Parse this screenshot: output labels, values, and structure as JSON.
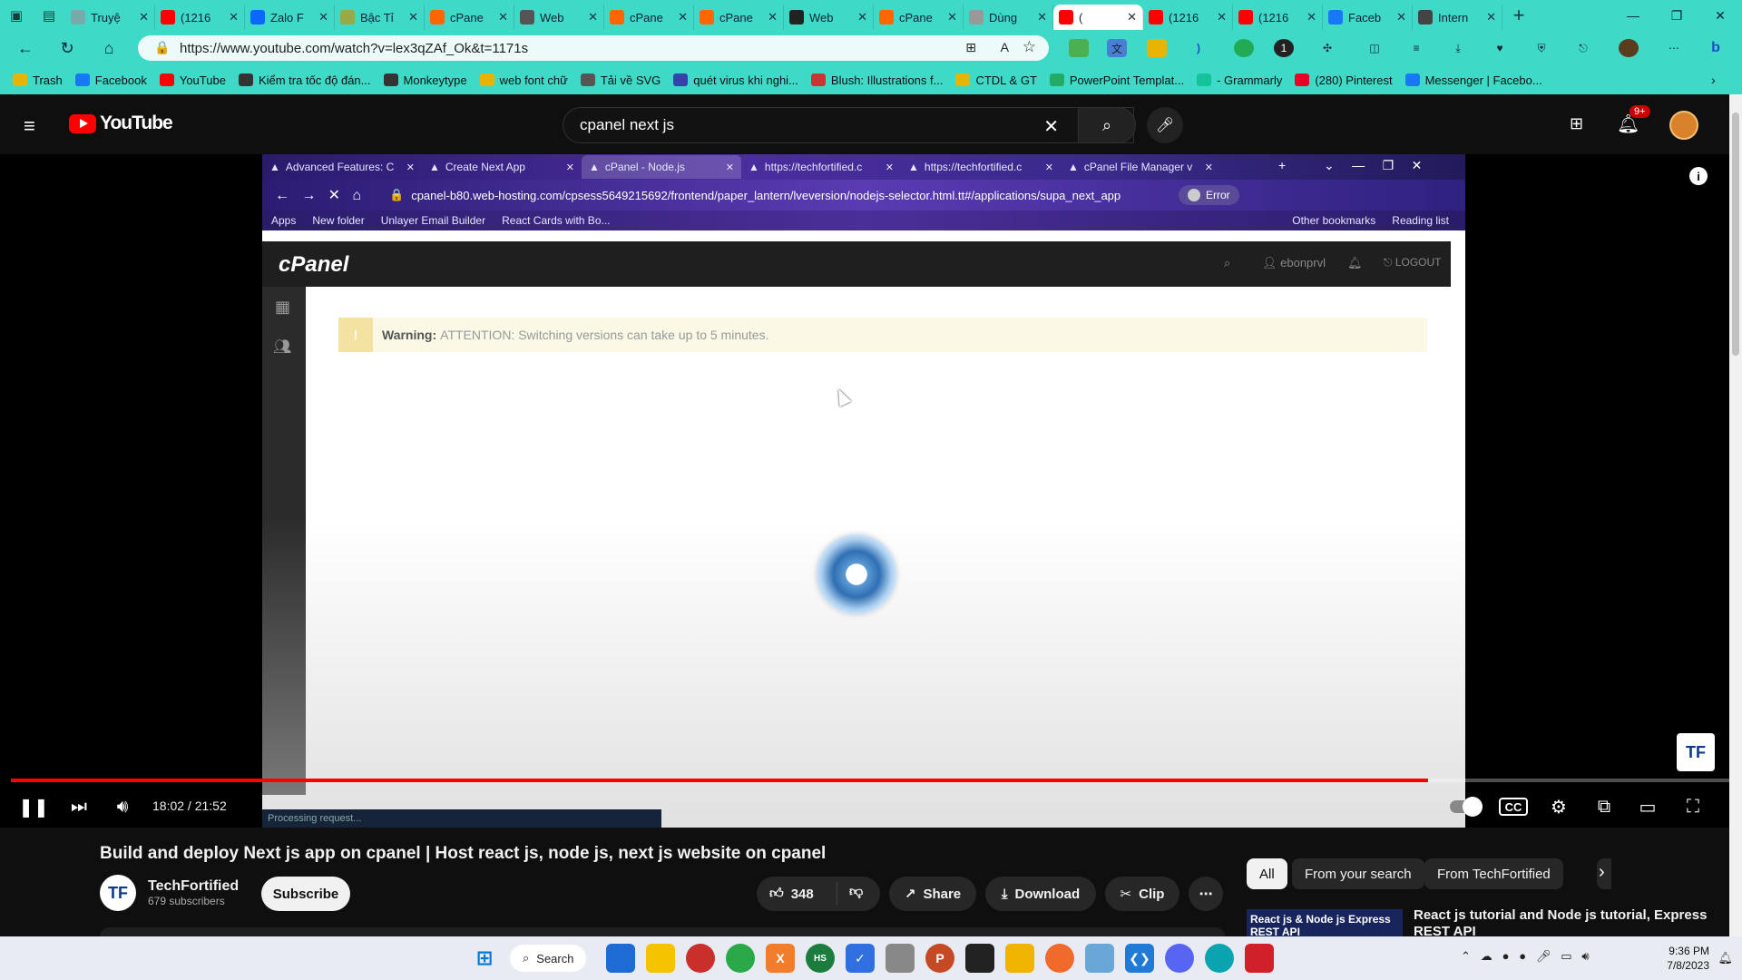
{
  "browser": {
    "tabs": [
      {
        "label": "Truyệ",
        "color": "#7aa"
      },
      {
        "label": "(1216",
        "color": "#f00"
      },
      {
        "label": "Zalo F",
        "color": "#0a68ff"
      },
      {
        "label": "Bậc Tỉ",
        "color": "#9a4"
      },
      {
        "label": "cPane",
        "color": "#f60"
      },
      {
        "label": "Web",
        "color": "#555"
      },
      {
        "label": "cPane",
        "color": "#f60"
      },
      {
        "label": "cPane",
        "color": "#f60"
      },
      {
        "label": "Web",
        "color": "#222"
      },
      {
        "label": "cPane",
        "color": "#f60"
      },
      {
        "label": "Dùng",
        "color": "#999"
      },
      {
        "label": "(",
        "color": "#f00",
        "active": true
      },
      {
        "label": "(1216",
        "color": "#f00"
      },
      {
        "label": "(1216",
        "color": "#f00"
      },
      {
        "label": "Faceb",
        "color": "#1877f2"
      },
      {
        "label": "Intern",
        "color": "#444"
      }
    ],
    "url": "https://www.youtube.com/watch?v=lex3qZAf_Ok&t=1171s",
    "bookmarks": [
      {
        "label": "Trash",
        "color": "#e8b400"
      },
      {
        "label": "Facebook",
        "color": "#1877f2"
      },
      {
        "label": "YouTube",
        "color": "#f00"
      },
      {
        "label": "Kiểm tra tốc độ đán...",
        "color": "#333"
      },
      {
        "label": "Monkeytype",
        "color": "#333"
      },
      {
        "label": "web font chữ",
        "color": "#e8b400"
      },
      {
        "label": "Tải về SVG",
        "color": "#555"
      },
      {
        "label": "quét virus khi nghi...",
        "color": "#3345aa"
      },
      {
        "label": "Blush: Illustrations f...",
        "color": "#c33"
      },
      {
        "label": "CTDL & GT",
        "color": "#e8b400"
      },
      {
        "label": "PowerPoint Templat...",
        "color": "#2a6"
      },
      {
        "label": "- Grammarly",
        "color": "#15c39a"
      },
      {
        "label": "(280) Pinterest",
        "color": "#e60023"
      },
      {
        "label": "Messenger | Facebo...",
        "color": "#1877f2"
      }
    ]
  },
  "youtube": {
    "logo_text": "YouTube",
    "search_query": "cpanel next js",
    "notification_count": "9+",
    "video": {
      "inner_tabs": [
        "Advanced Features: C",
        "Create Next App",
        "cPanel - Node.js",
        "https://techfortified.c",
        "https://techfortified.c",
        "cPanel File Manager v"
      ],
      "inner_url": "cpanel-b80.web-hosting.com/cpsess5649215692/frontend/paper_lantern/lveversion/nodejs-selector.html.tt#/applications/supa_next_app",
      "inner_bookmarks": [
        "Apps",
        "New folder",
        "Unlayer Email Builder",
        "React Cards with Bo...",
        "Other bookmarks",
        "Reading list"
      ],
      "inner_error": "Error",
      "cpanel_logo": "cPanel",
      "cpanel_user": "ebonprvl",
      "cpanel_logout": "LOGOUT",
      "warning_label": "Warning:",
      "warning_text": "ATTENTION: Switching versions can take up to 5 minutes.",
      "processing_text": "Processing request...",
      "time_current": "18:02",
      "time_total": "21:52",
      "progress_fraction": 0.824
    },
    "title": "Build and deploy Next js app on cpanel | Host react js, node js, next js website on cpanel",
    "channel": {
      "name": "TechFortified",
      "subscribers": "679 subscribers",
      "subscribe_label": "Subscribe"
    },
    "actions": {
      "likes": "348",
      "share": "Share",
      "download": "Download",
      "clip": "Clip"
    },
    "chips": [
      "All",
      "From your search",
      "From TechFortified"
    ],
    "recommendation": {
      "thumb_text": "React js & Node js Express REST API",
      "title": "React js tutorial and Node js tutorial, Express REST API"
    }
  },
  "taskbar": {
    "search_label": "Search",
    "time": "9:36 PM",
    "date": "7/8/2023"
  }
}
